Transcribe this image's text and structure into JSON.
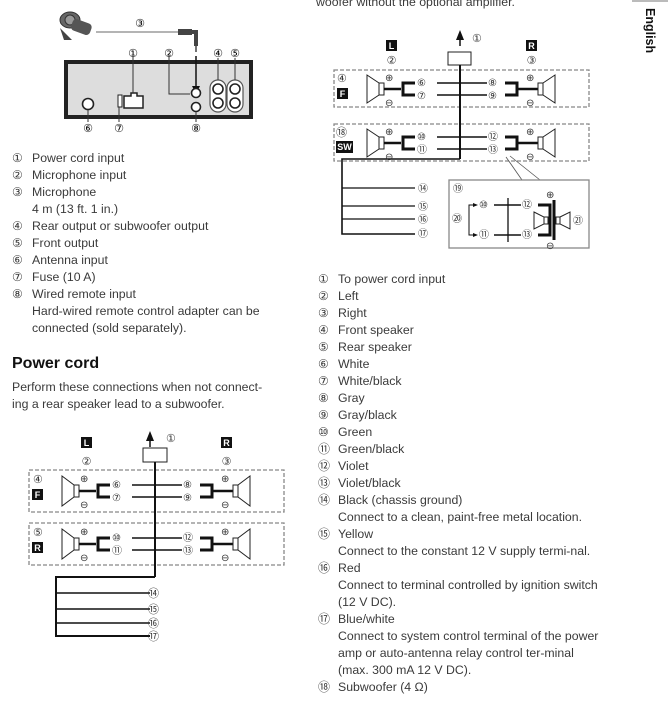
{
  "side_tab": {
    "label": "English"
  },
  "top_right_text": "woofer without the optional amplifier.",
  "unit_diagram": {
    "callouts": [
      "①",
      "②",
      "③",
      "④",
      "⑤",
      "⑥",
      "⑦",
      "⑧"
    ]
  },
  "unit_legend": [
    {
      "num": "①",
      "label": "Power cord input"
    },
    {
      "num": "②",
      "label": "Microphone input"
    },
    {
      "num": "③",
      "label": "Microphone",
      "detail": "4 m (13 ft. 1 in.)"
    },
    {
      "num": "④",
      "label": "Rear output or subwoofer output"
    },
    {
      "num": "⑤",
      "label": "Front output"
    },
    {
      "num": "⑥",
      "label": "Antenna input"
    },
    {
      "num": "⑦",
      "label": "Fuse (10 A)"
    },
    {
      "num": "⑧",
      "label": "Wired remote input",
      "detail": "Hard-wired remote control adapter can be connected (sold separately)."
    }
  ],
  "power_cord": {
    "heading": "Power cord",
    "intro": "Perform these connections when not connecting a rear speaker lead to a subwoofer.",
    "intro_line1": "Perform these connections when not connect-",
    "intro_line2": "ing a rear speaker lead to a subwoofer."
  },
  "diagram_left": {
    "L": "L",
    "R": "R",
    "F": "F",
    "Rr": "R",
    "c1": "①",
    "c2": "②",
    "c3": "③",
    "c4": "④",
    "c5": "⑤",
    "c6": "⑥",
    "c7": "⑦",
    "c8": "⑧",
    "c9": "⑨",
    "c10": "⑩",
    "c11": "⑪",
    "c12": "⑫",
    "c13": "⑬",
    "c14": "⑭",
    "c15": "⑮",
    "c16": "⑯",
    "c17": "⑰",
    "plus": "⊕",
    "minus": "⊖"
  },
  "diagram_right": {
    "L": "L",
    "R": "R",
    "F": "F",
    "SW": "SW",
    "c1": "①",
    "c2": "②",
    "c3": "③",
    "c4": "④",
    "c18": "⑱",
    "c6": "⑥",
    "c7": "⑦",
    "c8": "⑧",
    "c9": "⑨",
    "c10": "⑩",
    "c11": "⑪",
    "c12": "⑫",
    "c13": "⑬",
    "c14": "⑭",
    "c15": "⑮",
    "c16": "⑯",
    "c17": "⑰",
    "c19": "⑲",
    "c20": "⑳",
    "c21": "㉑",
    "plus": "⊕",
    "minus": "⊖"
  },
  "wire_legend": [
    {
      "num": "①",
      "label": "To power cord input"
    },
    {
      "num": "②",
      "label": "Left"
    },
    {
      "num": "③",
      "label": "Right"
    },
    {
      "num": "④",
      "label": "Front speaker"
    },
    {
      "num": "⑤",
      "label": "Rear speaker"
    },
    {
      "num": "⑥",
      "label": "White"
    },
    {
      "num": "⑦",
      "label": "White/black"
    },
    {
      "num": "⑧",
      "label": "Gray"
    },
    {
      "num": "⑨",
      "label": "Gray/black"
    },
    {
      "num": "⑩",
      "label": "Green"
    },
    {
      "num": "⑪",
      "label": "Green/black"
    },
    {
      "num": "⑫",
      "label": "Violet"
    },
    {
      "num": "⑬",
      "label": "Violet/black"
    },
    {
      "num": "⑭",
      "label": "Black (chassis ground)",
      "detail": "Connect to a clean, paint-free metal location."
    },
    {
      "num": "⑮",
      "label": "Yellow",
      "detail": "Connect to the constant 12 V supply termi-nal."
    },
    {
      "num": "⑯",
      "label": "Red",
      "detail": "Connect to terminal controlled by ignition switch (12 V DC)."
    },
    {
      "num": "⑰",
      "label": "Blue/white",
      "detail": "Connect to system control terminal of the power amp or auto-antenna relay control ter-minal (max. 300 mA 12 V DC)."
    },
    {
      "num": "⑱",
      "label": "Subwoofer (4 Ω)"
    }
  ]
}
